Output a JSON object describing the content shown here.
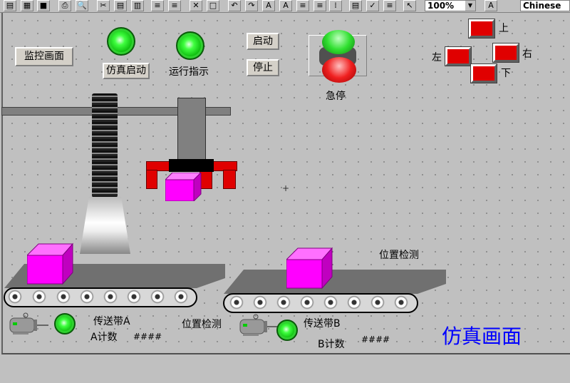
{
  "toolbar": {
    "zoom": "100%",
    "language": "Chinese",
    "icons": [
      "copy-icon",
      "paint-icon",
      "save-icon",
      "print-icon",
      "preview-icon",
      "cut-icon",
      "paste-icon",
      "paste2-icon",
      "align-icon",
      "align2-icon",
      "tools-icon",
      "frame-icon",
      "undo-icon",
      "redo-icon",
      "font-size-icon",
      "font-up-icon",
      "list-icon",
      "list2-icon",
      "grid-icon",
      "page-icon",
      "check-icon",
      "sort-icon",
      "pointer-icon",
      "font-icon"
    ]
  },
  "buttons": {
    "monitor": "监控画面",
    "sim_start": "仿真启动",
    "start": "启动",
    "stop": "停止"
  },
  "labels": {
    "run_indicator": "运行指示",
    "estop": "急停",
    "up": "上",
    "left": "左",
    "right": "右",
    "down": "下",
    "pos_detect_1": "位置检测",
    "pos_detect_2": "位置检测",
    "belt_a": "传送带A",
    "belt_b": "传送带B",
    "count_a": "A计数",
    "count_b": "B计数",
    "count_a_value": "####",
    "count_b_value": "####",
    "title": "仿真画面"
  },
  "colors": {
    "lamp_on": "#20e020",
    "red": "#e00000",
    "magenta": "#ff00ff",
    "title": "#0000ff"
  }
}
